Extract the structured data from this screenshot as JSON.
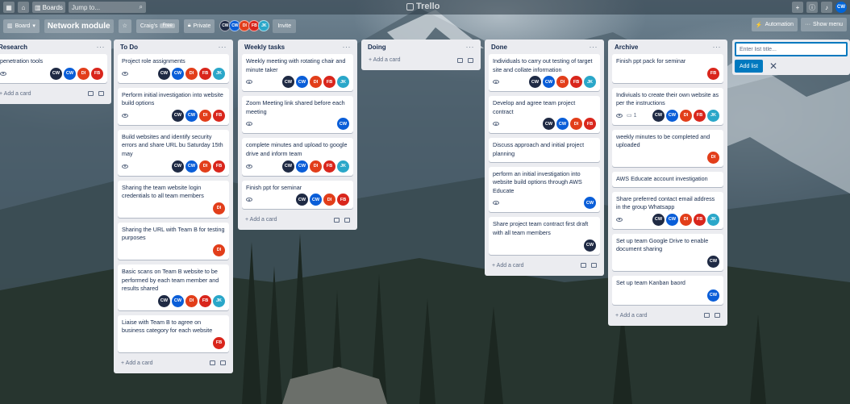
{
  "header": {
    "apps_icon": "grid-icon",
    "home_icon": "home-icon",
    "boards_label": "Boards",
    "search_placeholder": "Jump to...",
    "logo": "Trello",
    "me_initials": "CW"
  },
  "board": {
    "switch_label": "Board",
    "name": "Network module",
    "team": "Craig's",
    "free": "Free",
    "visibility": "Private",
    "invite": "Invite",
    "automation": "Automation",
    "show_menu": "Show menu",
    "members": [
      {
        "initials": "CW",
        "color": "#1f2a44"
      },
      {
        "initials": "CW",
        "color": "#0a5ed8"
      },
      {
        "initials": "DI",
        "color": "#e23e1a"
      },
      {
        "initials": "FB",
        "color": "#d9261c"
      },
      {
        "initials": "JK",
        "color": "#2aa7c9"
      }
    ]
  },
  "member_colors": {
    "CW1": "#1f2a44",
    "CW2": "#0a5ed8",
    "DI": "#e23e1a",
    "FB": "#d9261c",
    "JK": "#2aa7c9"
  },
  "lists": [
    {
      "title": "Research",
      "cards": [
        {
          "title": "penetration tools"
        }
      ],
      "add_card": "Add a card"
    },
    {
      "title": "To Do",
      "cards": [
        {
          "title": "Project role assignments"
        },
        {
          "title": "Perform initial investigation into website build options"
        },
        {
          "title": "Build websites and identify security errors and share URL bu Saturday 15th may"
        },
        {
          "title": "Sharing the team website login credentials to all team members"
        },
        {
          "title": "Sharing the URL with Team B for testing purposes"
        },
        {
          "title": "Basic scans on Team B website to be performed by each team member and results shared"
        },
        {
          "title": "Liaise with Team B to agree on business category for each website"
        }
      ],
      "add_card": "Add a card"
    },
    {
      "title": "Weekly tasks",
      "cards": [
        {
          "title": "Weekly meeting with rotating chair and minute taker"
        },
        {
          "title": "Zoom Meeting link shared before each meeting"
        },
        {
          "title": "complete minutes and upload to google drive and inform team"
        },
        {
          "title": "Finish ppt for seminar"
        }
      ],
      "add_card": "Add a card"
    },
    {
      "title": "Doing",
      "cards": [],
      "add_card": "Add a card"
    },
    {
      "title": "Done",
      "cards": [
        {
          "title": "Individuals to carry out testing of target site and collate information"
        },
        {
          "title": "Develop and agree team project contract"
        },
        {
          "title": "Discuss approach and initial project planning"
        },
        {
          "title": "perform an initial investigation into website build options through AWS Educate"
        },
        {
          "title": "Share project team contract first draft with all team members"
        }
      ],
      "add_card": "Add a card"
    },
    {
      "title": "Archive",
      "cards": [
        {
          "title": "Finish ppt pack for seminar"
        },
        {
          "title": "Indiviuals to create their own website as per the instructions",
          "comments": "1"
        },
        {
          "title": "weekly minutes to be completed and uploaded"
        },
        {
          "title": "AWS Educate account investigation"
        },
        {
          "title": "Share preferred contact email address in the group Whatsapp"
        },
        {
          "title": "Set up team Google Drive to enable document sharing"
        },
        {
          "title": "Set up team Kanban baord"
        }
      ],
      "add_card": "Add a card"
    }
  ],
  "add_list": {
    "placeholder": "Enter list title...",
    "button": "Add list",
    "close_icon": "close-icon"
  }
}
